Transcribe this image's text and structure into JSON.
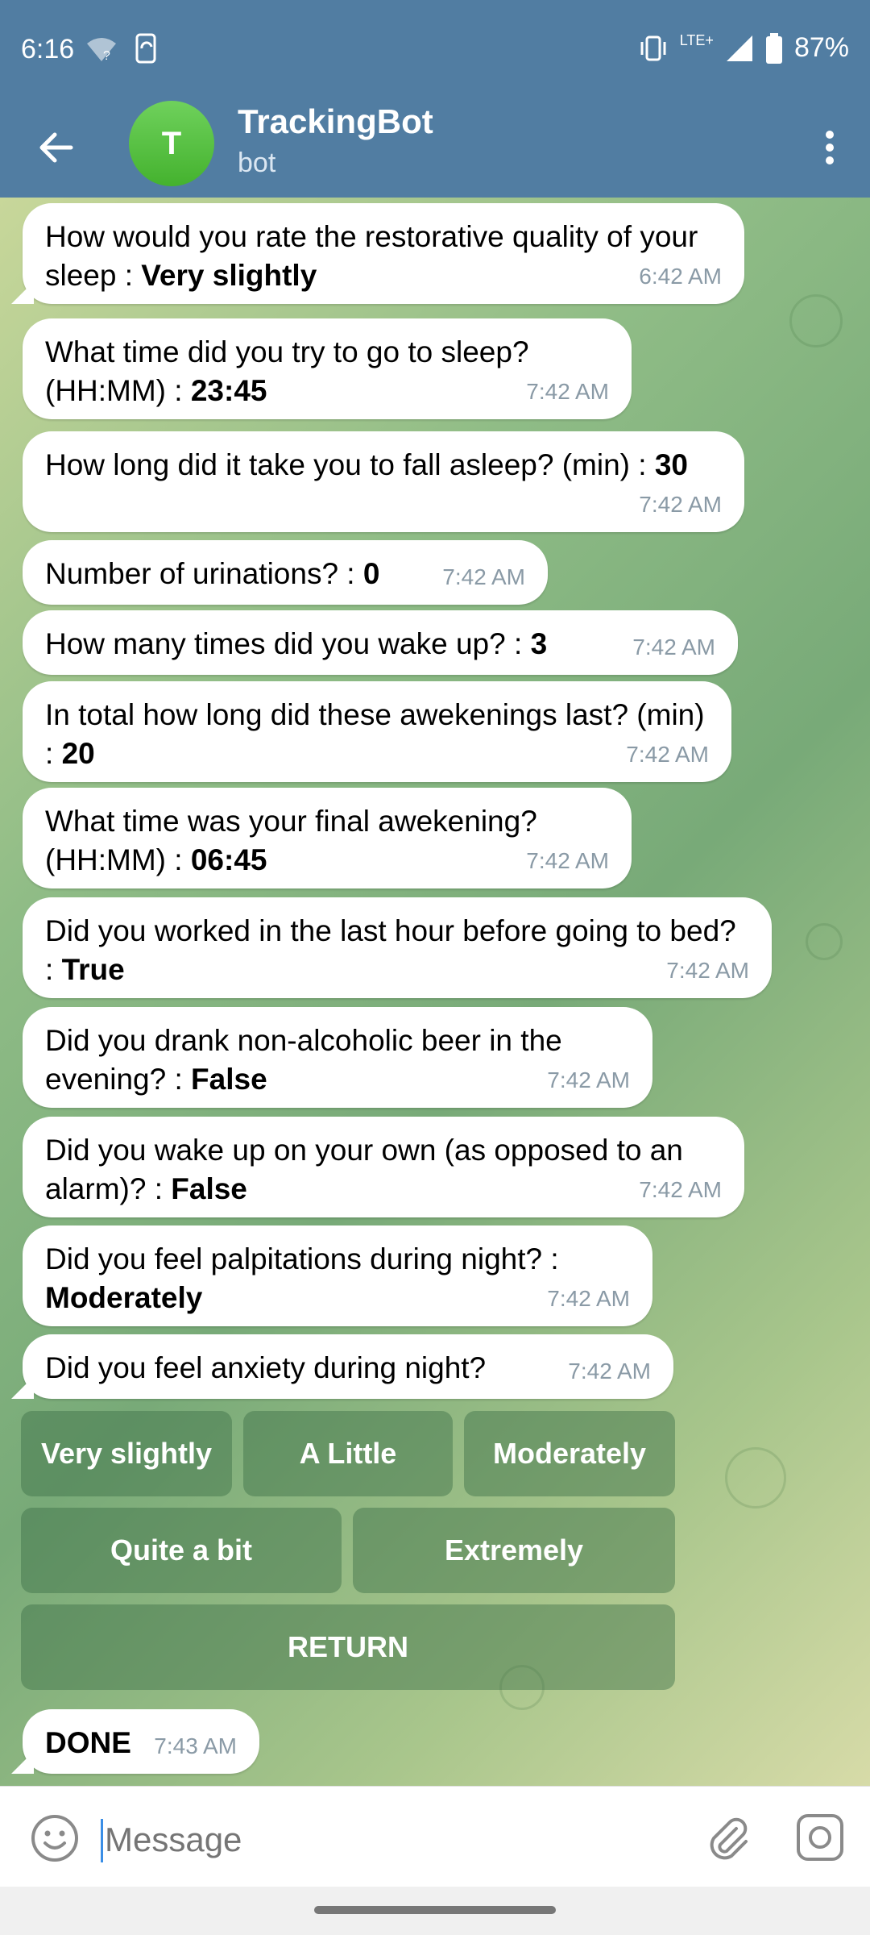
{
  "status_bar": {
    "time": "6:16",
    "battery": "87%",
    "network": "LTE+"
  },
  "header": {
    "avatar_letter": "T",
    "title": "TrackingBot",
    "subtitle": "bot"
  },
  "messages": [
    {
      "text": "How would you rate the restorative quality of your sleep : ",
      "answer": "Very slightly",
      "time": "6:42 AM"
    },
    {
      "text": "What time did you try to go to sleep? (HH:MM) : ",
      "answer": "23:45",
      "time": "7:42 AM"
    },
    {
      "text": "How long did it take you to fall asleep? (min) : ",
      "answer": "30",
      "time": "7:42 AM"
    },
    {
      "text": "Number of urinations? : ",
      "answer": "0",
      "time": "7:42 AM"
    },
    {
      "text": "How many times did you wake up? : ",
      "answer": "3",
      "time": "7:42 AM"
    },
    {
      "text": "In total how long did these awekenings last? (min) : ",
      "answer": "20",
      "time": "7:42 AM"
    },
    {
      "text": "What time was your final awekening? (HH:MM) : ",
      "answer": "06:45",
      "time": "7:42 AM"
    },
    {
      "text": "Did you worked in the last hour before going to bed? : ",
      "answer": "True",
      "time": "7:42 AM"
    },
    {
      "text": "Did you drank non-alcoholic beer in the evening? : ",
      "answer": "False",
      "time": "7:42 AM"
    },
    {
      "text": "Did you wake up on your own (as opposed to an alarm)? : ",
      "answer": "False",
      "time": "7:42 AM"
    },
    {
      "text": "Did you feel palpitations during night? : ",
      "answer": "Moderately",
      "time": "7:42 AM"
    },
    {
      "text": "Did you feel anxiety during night?",
      "answer": "",
      "time": "7:42 AM"
    },
    {
      "text": "",
      "answer": "DONE",
      "time": "7:43 AM"
    }
  ],
  "keyboard": {
    "very_slightly": "Very slightly",
    "a_little": "A Little",
    "moderately": "Moderately",
    "quite_a_bit": "Quite a bit",
    "extremely": "Extremely",
    "return": "RETURN"
  },
  "input": {
    "placeholder": "Message"
  },
  "colors": {
    "header": "#517da2",
    "avatar": "#4cb834",
    "bubble": "#ffffff"
  }
}
